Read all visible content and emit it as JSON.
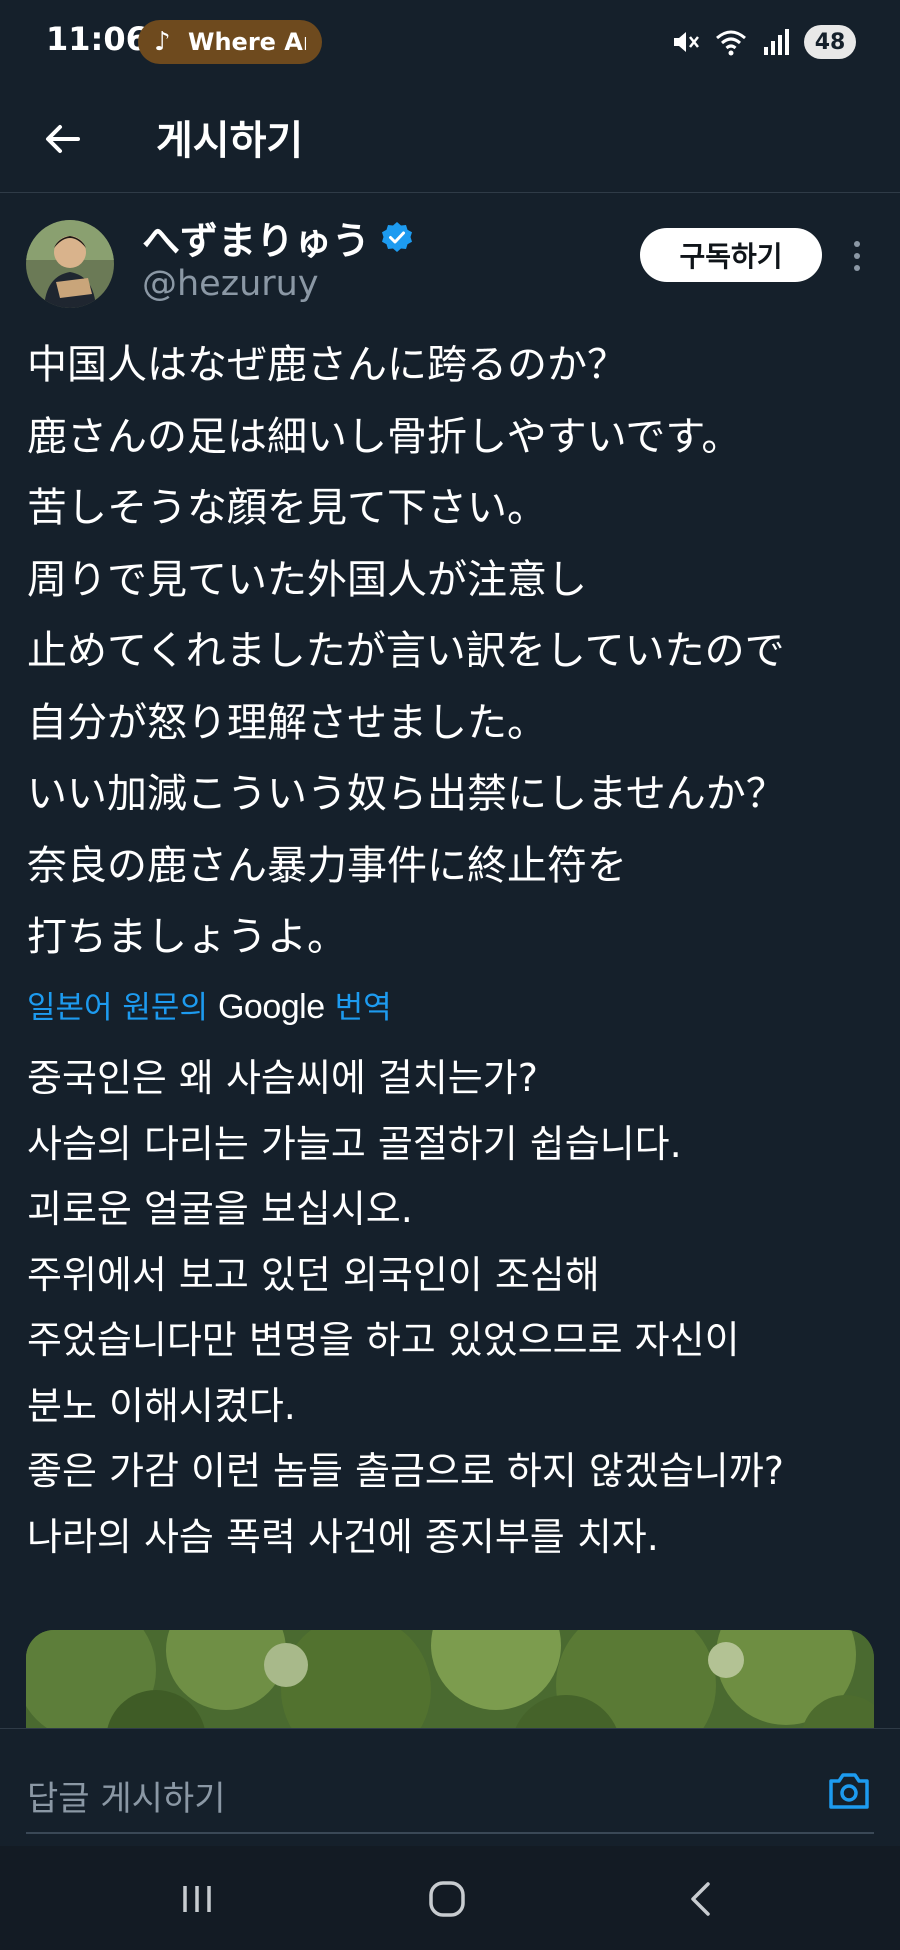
{
  "status_bar": {
    "time": "11:06",
    "media_track": "Where Ar",
    "battery": "48"
  },
  "header": {
    "title": "게시하기"
  },
  "post": {
    "display_name": "へずまりゅう",
    "handle": "@hezuruy",
    "subscribe_label": "구독하기",
    "text_lines": [
      "中国人はなぜ鹿さんに跨るのか？",
      "鹿さんの足は細いし骨折しやすいです。",
      "苦しそうな顔を見て下さい。",
      "周りで見ていた外国人が注意し",
      "止めてくれましたが言い訳をしていたので",
      "自分が怒り理解させました。",
      "いい加減こういう奴ら出禁にしませんか？",
      "奈良の鹿さん暴力事件に終止符を",
      "打ちましょうよ。"
    ],
    "translation_prefix": "일본어 원문의",
    "translation_provider": "Google",
    "translation_suffix": "번역",
    "translated_lines": [
      "중국인은 왜 사슴씨에 걸치는가?",
      "사슴의 다리는 가늘고 골절하기 쉽습니다.",
      "괴로운 얼굴을 보십시오.",
      "주위에서 보고 있던 외국인이 조심해",
      "주었습니다만 변명을 하고 있었으므로 자신이",
      "분노 이해시켰다.",
      "좋은 가감 이런 놈들 출금으로 하지 않겠습니까?",
      "나라의 사슴 폭력 사건에 종지부를 치자."
    ]
  },
  "reply": {
    "placeholder": "답글 게시하기"
  },
  "icons": {
    "verified": "verified-badge-icon",
    "camera": "camera-icon",
    "back": "arrow-left-icon"
  },
  "colors": {
    "background": "#15202b",
    "accent": "#1d9bf0",
    "secondary_text": "#8b98a5",
    "media_pill": "#6e4a1e"
  }
}
